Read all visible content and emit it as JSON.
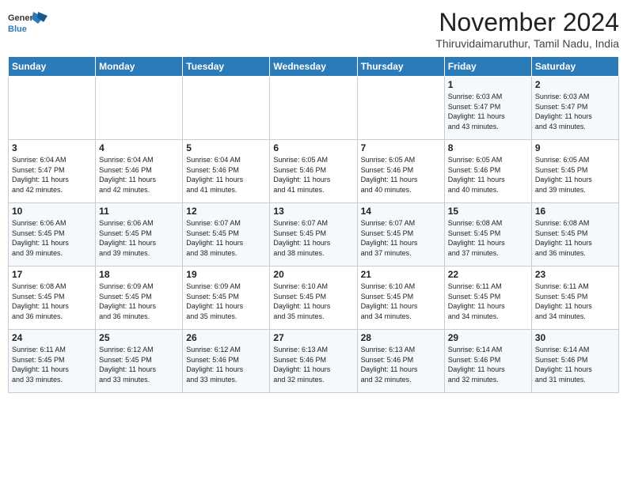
{
  "header": {
    "logo_line1": "General",
    "logo_line2": "Blue",
    "month": "November 2024",
    "location": "Thiruvidaimaruthur, Tamil Nadu, India"
  },
  "weekdays": [
    "Sunday",
    "Monday",
    "Tuesday",
    "Wednesday",
    "Thursday",
    "Friday",
    "Saturday"
  ],
  "weeks": [
    [
      {
        "day": "",
        "info": ""
      },
      {
        "day": "",
        "info": ""
      },
      {
        "day": "",
        "info": ""
      },
      {
        "day": "",
        "info": ""
      },
      {
        "day": "",
        "info": ""
      },
      {
        "day": "1",
        "info": "Sunrise: 6:03 AM\nSunset: 5:47 PM\nDaylight: 11 hours\nand 43 minutes."
      },
      {
        "day": "2",
        "info": "Sunrise: 6:03 AM\nSunset: 5:47 PM\nDaylight: 11 hours\nand 43 minutes."
      }
    ],
    [
      {
        "day": "3",
        "info": "Sunrise: 6:04 AM\nSunset: 5:47 PM\nDaylight: 11 hours\nand 42 minutes."
      },
      {
        "day": "4",
        "info": "Sunrise: 6:04 AM\nSunset: 5:46 PM\nDaylight: 11 hours\nand 42 minutes."
      },
      {
        "day": "5",
        "info": "Sunrise: 6:04 AM\nSunset: 5:46 PM\nDaylight: 11 hours\nand 41 minutes."
      },
      {
        "day": "6",
        "info": "Sunrise: 6:05 AM\nSunset: 5:46 PM\nDaylight: 11 hours\nand 41 minutes."
      },
      {
        "day": "7",
        "info": "Sunrise: 6:05 AM\nSunset: 5:46 PM\nDaylight: 11 hours\nand 40 minutes."
      },
      {
        "day": "8",
        "info": "Sunrise: 6:05 AM\nSunset: 5:46 PM\nDaylight: 11 hours\nand 40 minutes."
      },
      {
        "day": "9",
        "info": "Sunrise: 6:05 AM\nSunset: 5:45 PM\nDaylight: 11 hours\nand 39 minutes."
      }
    ],
    [
      {
        "day": "10",
        "info": "Sunrise: 6:06 AM\nSunset: 5:45 PM\nDaylight: 11 hours\nand 39 minutes."
      },
      {
        "day": "11",
        "info": "Sunrise: 6:06 AM\nSunset: 5:45 PM\nDaylight: 11 hours\nand 39 minutes."
      },
      {
        "day": "12",
        "info": "Sunrise: 6:07 AM\nSunset: 5:45 PM\nDaylight: 11 hours\nand 38 minutes."
      },
      {
        "day": "13",
        "info": "Sunrise: 6:07 AM\nSunset: 5:45 PM\nDaylight: 11 hours\nand 38 minutes."
      },
      {
        "day": "14",
        "info": "Sunrise: 6:07 AM\nSunset: 5:45 PM\nDaylight: 11 hours\nand 37 minutes."
      },
      {
        "day": "15",
        "info": "Sunrise: 6:08 AM\nSunset: 5:45 PM\nDaylight: 11 hours\nand 37 minutes."
      },
      {
        "day": "16",
        "info": "Sunrise: 6:08 AM\nSunset: 5:45 PM\nDaylight: 11 hours\nand 36 minutes."
      }
    ],
    [
      {
        "day": "17",
        "info": "Sunrise: 6:08 AM\nSunset: 5:45 PM\nDaylight: 11 hours\nand 36 minutes."
      },
      {
        "day": "18",
        "info": "Sunrise: 6:09 AM\nSunset: 5:45 PM\nDaylight: 11 hours\nand 36 minutes."
      },
      {
        "day": "19",
        "info": "Sunrise: 6:09 AM\nSunset: 5:45 PM\nDaylight: 11 hours\nand 35 minutes."
      },
      {
        "day": "20",
        "info": "Sunrise: 6:10 AM\nSunset: 5:45 PM\nDaylight: 11 hours\nand 35 minutes."
      },
      {
        "day": "21",
        "info": "Sunrise: 6:10 AM\nSunset: 5:45 PM\nDaylight: 11 hours\nand 34 minutes."
      },
      {
        "day": "22",
        "info": "Sunrise: 6:11 AM\nSunset: 5:45 PM\nDaylight: 11 hours\nand 34 minutes."
      },
      {
        "day": "23",
        "info": "Sunrise: 6:11 AM\nSunset: 5:45 PM\nDaylight: 11 hours\nand 34 minutes."
      }
    ],
    [
      {
        "day": "24",
        "info": "Sunrise: 6:11 AM\nSunset: 5:45 PM\nDaylight: 11 hours\nand 33 minutes."
      },
      {
        "day": "25",
        "info": "Sunrise: 6:12 AM\nSunset: 5:45 PM\nDaylight: 11 hours\nand 33 minutes."
      },
      {
        "day": "26",
        "info": "Sunrise: 6:12 AM\nSunset: 5:46 PM\nDaylight: 11 hours\nand 33 minutes."
      },
      {
        "day": "27",
        "info": "Sunrise: 6:13 AM\nSunset: 5:46 PM\nDaylight: 11 hours\nand 32 minutes."
      },
      {
        "day": "28",
        "info": "Sunrise: 6:13 AM\nSunset: 5:46 PM\nDaylight: 11 hours\nand 32 minutes."
      },
      {
        "day": "29",
        "info": "Sunrise: 6:14 AM\nSunset: 5:46 PM\nDaylight: 11 hours\nand 32 minutes."
      },
      {
        "day": "30",
        "info": "Sunrise: 6:14 AM\nSunset: 5:46 PM\nDaylight: 11 hours\nand 31 minutes."
      }
    ]
  ]
}
